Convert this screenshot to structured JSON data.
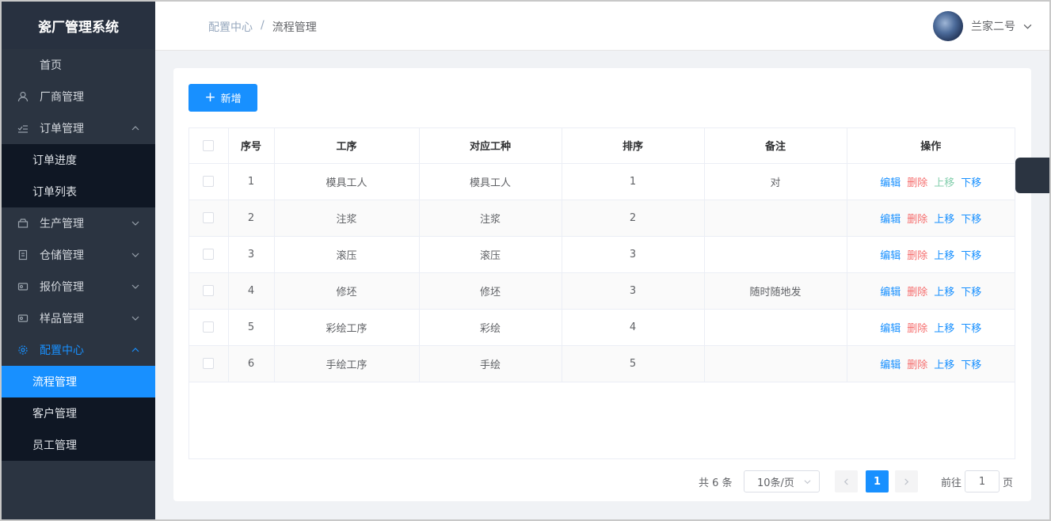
{
  "sidebar": {
    "title": "瓷厂管理系统",
    "items": [
      {
        "label": "首页"
      },
      {
        "label": "厂商管理"
      },
      {
        "label": "订单管理"
      },
      {
        "label": "生产管理"
      },
      {
        "label": "仓储管理"
      },
      {
        "label": "报价管理"
      },
      {
        "label": "样品管理"
      },
      {
        "label": "配置中心"
      }
    ],
    "order_sub": [
      {
        "label": "订单进度"
      },
      {
        "label": "订单列表"
      }
    ],
    "config_sub": [
      {
        "label": "流程管理"
      },
      {
        "label": "客户管理"
      },
      {
        "label": "员工管理"
      }
    ]
  },
  "header": {
    "breadcrumb": [
      "配置中心",
      "/",
      "流程管理"
    ],
    "user": "兰家二号"
  },
  "toolbar": {
    "add_label": "新增",
    "add_icon": "+"
  },
  "table": {
    "columns": [
      "序号",
      "工序",
      "对应工种",
      "排序",
      "备注",
      "操作"
    ],
    "rows": [
      {
        "no": "1",
        "process": "模具工人",
        "worker": "模具工人",
        "order": "1",
        "note": "对"
      },
      {
        "no": "2",
        "process": "注浆",
        "worker": "注浆",
        "order": "2",
        "note": ""
      },
      {
        "no": "3",
        "process": "滚压",
        "worker": "滚压",
        "order": "3",
        "note": ""
      },
      {
        "no": "4",
        "process": "修坯",
        "worker": "修坯",
        "order": "3",
        "note": "随时随地发"
      },
      {
        "no": "5",
        "process": "彩绘工序",
        "worker": "彩绘",
        "order": "4",
        "note": ""
      },
      {
        "no": "6",
        "process": "手绘工序",
        "worker": "手绘",
        "order": "5",
        "note": ""
      }
    ],
    "actions": {
      "edit": "编辑",
      "delete": "删除",
      "up": "上移",
      "down": "下移"
    }
  },
  "pagination": {
    "total": "共 6 条",
    "page_size": "10条/页",
    "current": "1",
    "goto_label": "前往",
    "goto_value": "1",
    "goto_suffix": "页"
  },
  "colors": {
    "accent": "#1890ff",
    "sidebar": "#2b3441",
    "danger": "#f56c6c"
  }
}
